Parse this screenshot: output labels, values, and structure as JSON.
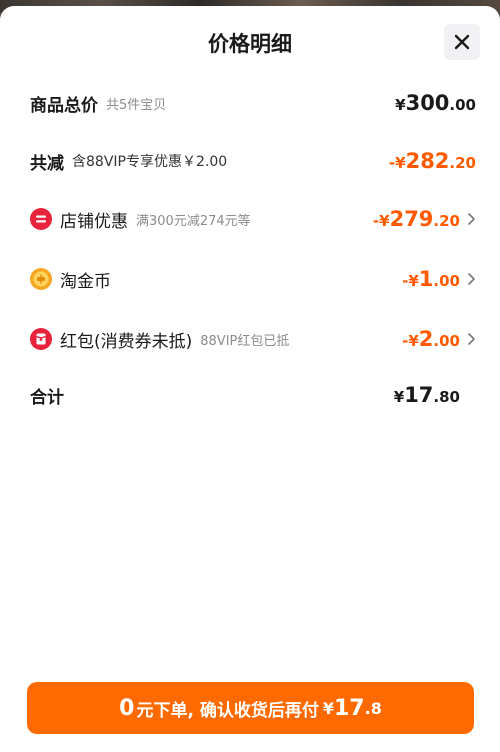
{
  "header": {
    "title": "价格明细",
    "close_icon": "close-icon"
  },
  "rows": {
    "total_goods": {
      "label": "商品总价",
      "sub": "共5件宝贝",
      "yen": "¥",
      "int": "300",
      "dec": ".00"
    },
    "total_discount": {
      "label": "共减",
      "sub": "含88VIP专享优惠￥2.00",
      "yen": "-¥",
      "int": "282",
      "dec": ".20"
    },
    "store_discount": {
      "icon": "store-discount-icon",
      "label": "店铺优惠",
      "sub": "满300元减274元等",
      "yen": "-¥",
      "int": "279",
      "dec": ".20"
    },
    "taojinbi": {
      "icon": "coin-icon",
      "label": "淘金币",
      "yen": "-¥",
      "int": "1",
      "dec": ".00"
    },
    "red_packet": {
      "icon": "red-packet-icon",
      "label": "红包(消费券未抵)",
      "sub": "88VIP红包已抵",
      "yen": "-¥",
      "int": "2",
      "dec": ".00"
    },
    "subtotal": {
      "label": "合计",
      "yen": "¥",
      "int": "17",
      "dec": ".80"
    }
  },
  "cta": {
    "zero": "0",
    "text": "元下单, 确认收货后再付",
    "yen": "¥",
    "int": "17",
    "dec": ".8"
  },
  "colors": {
    "accent": "#ff6a00",
    "discount_text": "#ff5a00",
    "icon_red": "#e8243c",
    "coin_gold": "#f5a623"
  }
}
